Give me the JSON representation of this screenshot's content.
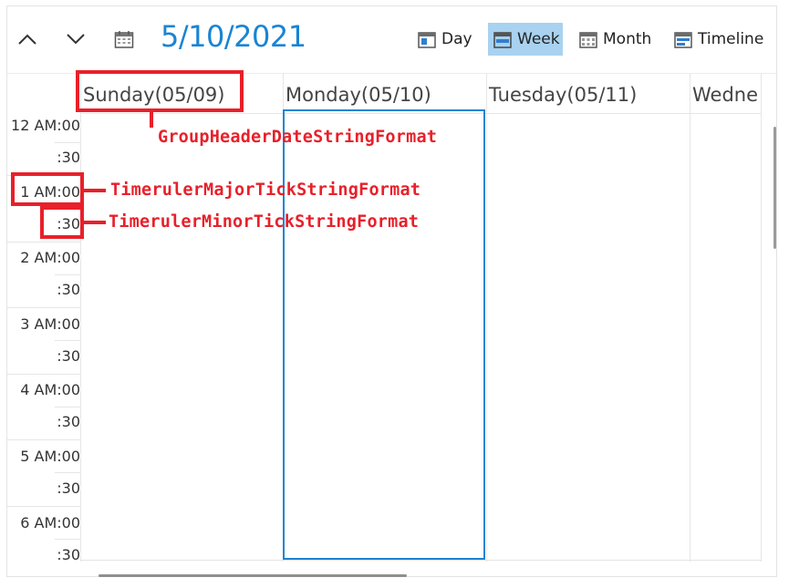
{
  "toolbar": {
    "date_title": "5/10/2021",
    "views": [
      {
        "label": "Day",
        "icon": "calendar-day-icon",
        "selected": false
      },
      {
        "label": "Week",
        "icon": "calendar-week-icon",
        "selected": true
      },
      {
        "label": "Month",
        "icon": "calendar-month-icon",
        "selected": false
      },
      {
        "label": "Timeline",
        "icon": "calendar-timeline-icon",
        "selected": false
      }
    ]
  },
  "day_headers": [
    "Sunday(05/09)",
    "Monday(05/10)",
    "Tuesday(05/11)",
    "Wedne"
  ],
  "time_ruler": [
    {
      "major": "12 AM:00",
      "minor": ":30"
    },
    {
      "major": "1 AM:00",
      "minor": ":30"
    },
    {
      "major": "2 AM:00",
      "minor": ":30"
    },
    {
      "major": "3 AM:00",
      "minor": ":30"
    },
    {
      "major": "4 AM:00",
      "minor": ":30"
    },
    {
      "major": "5 AM:00",
      "minor": ":30"
    },
    {
      "major": "6 AM:00",
      "minor": ":30"
    }
  ],
  "annotations": {
    "group_header": "GroupHeaderDateStringFormat",
    "major_tick": "TimerulerMajorTickStringFormat",
    "minor_tick": "TimerulerMinorTickStringFormat"
  },
  "colors": {
    "accent": "#1a84d4",
    "selected_view_bg": "#a8d2f0",
    "annotation": "#e8202a"
  }
}
